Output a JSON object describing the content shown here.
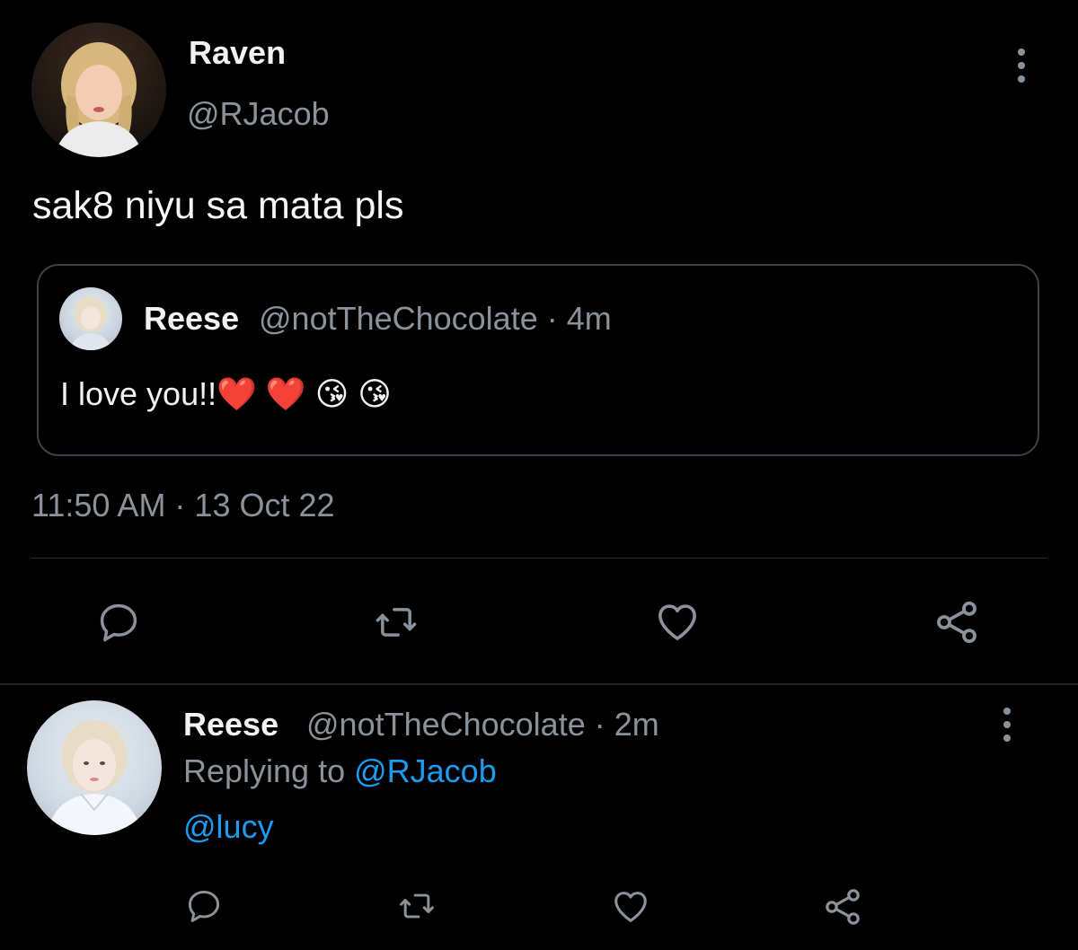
{
  "main_tweet": {
    "author_name": "Raven",
    "author_handle": "@RJacob",
    "text": "sak8 niyu sa mata pls",
    "timestamp": "11:50 AM · 13 Oct 22",
    "quoted_tweet": {
      "author_name": "Reese",
      "meta": "@notTheChocolate · 4m",
      "text": "I love you!!❤️ ❤️ 😘 😘"
    },
    "actions": [
      "reply-icon",
      "retweet-icon",
      "like-icon",
      "share-icon"
    ]
  },
  "reply_tweet": {
    "author_name": "Reese",
    "meta": "@notTheChocolate · 2m",
    "replying_prefix": "Replying to ",
    "replying_handle": "@RJacob",
    "text": "@lucy",
    "actions": [
      "reply-icon",
      "retweet-icon",
      "like-icon",
      "share-icon"
    ]
  },
  "colors": {
    "background": "#000000",
    "text_primary": "#f2f2f2",
    "text_secondary": "#8a939c",
    "link": "#1d9bf0",
    "border": "#3a4148"
  }
}
